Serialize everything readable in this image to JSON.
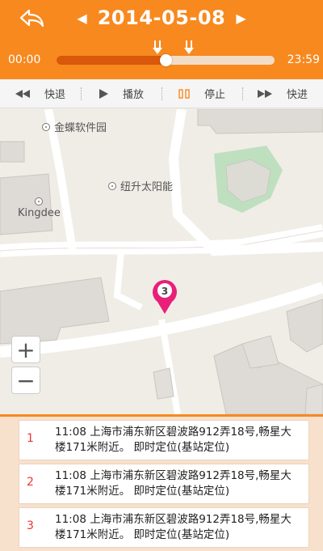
{
  "header": {
    "date": "2014-05-08",
    "time_start": "00:00",
    "time_end": "23:59",
    "timeline_progress": 0.5
  },
  "controls": [
    {
      "label": "快退",
      "icon": "rewind-icon"
    },
    {
      "label": "播放",
      "icon": "play-icon"
    },
    {
      "label": "停止",
      "icon": "pause-icon"
    },
    {
      "label": "快进",
      "icon": "fast-forward-icon"
    }
  ],
  "map": {
    "pois": [
      {
        "label": "金蝶软件园"
      },
      {
        "label": "纽升太阳能"
      },
      {
        "label": "Kingdee"
      }
    ],
    "pin_label": "3",
    "zoom_in": "+",
    "zoom_out": "−"
  },
  "locations": [
    {
      "num": "1",
      "text": "11:08 上海市浦东新区碧波路912弄18号,畅星大楼171米附近。 即时定位(基站定位)"
    },
    {
      "num": "2",
      "text": "11:08 上海市浦东新区碧波路912弄18号,畅星大楼171米附近。 即时定位(基站定位)"
    },
    {
      "num": "3",
      "text": "11:08 上海市浦东新区碧波路912弄18号,畅星大楼171米附近。 即时定位(基站定位)"
    }
  ],
  "colors": {
    "accent": "#f7891f",
    "progress": "#d9580a",
    "pin": "#e8207a"
  }
}
